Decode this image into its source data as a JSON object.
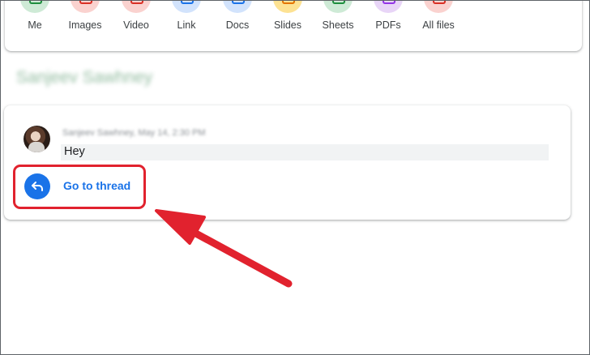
{
  "filters": [
    {
      "label": "Me",
      "icon": "person-icon",
      "bg": "#ceead6",
      "fg": "#1e8e3e"
    },
    {
      "label": "Images",
      "icon": "image-icon",
      "bg": "#fad2cf",
      "fg": "#d93025"
    },
    {
      "label": "Video",
      "icon": "video-icon",
      "bg": "#fad2cf",
      "fg": "#d93025"
    },
    {
      "label": "Link",
      "icon": "link-icon",
      "bg": "#d2e3fc",
      "fg": "#1a73e8"
    },
    {
      "label": "Docs",
      "icon": "docs-icon",
      "bg": "#d2e3fc",
      "fg": "#1a73e8"
    },
    {
      "label": "Slides",
      "icon": "slides-icon",
      "bg": "#fde293",
      "fg": "#e37400"
    },
    {
      "label": "Sheets",
      "icon": "sheets-icon",
      "bg": "#ceead6",
      "fg": "#1e8e3e"
    },
    {
      "label": "PDFs",
      "icon": "pdf-icon",
      "bg": "#e8d5f7",
      "fg": "#9334e6"
    },
    {
      "label": "All files",
      "icon": "files-icon",
      "bg": "#fad2cf",
      "fg": "#d93025"
    }
  ],
  "result": {
    "sender_heading_blurred": "Sanjeev Sawhney",
    "meta_blurred": "Sanjeev Sawhney, May 14, 2:30 PM",
    "message": "Hey",
    "thread_button": "Go to thread"
  },
  "annotation": {
    "color": "#e1222e"
  }
}
